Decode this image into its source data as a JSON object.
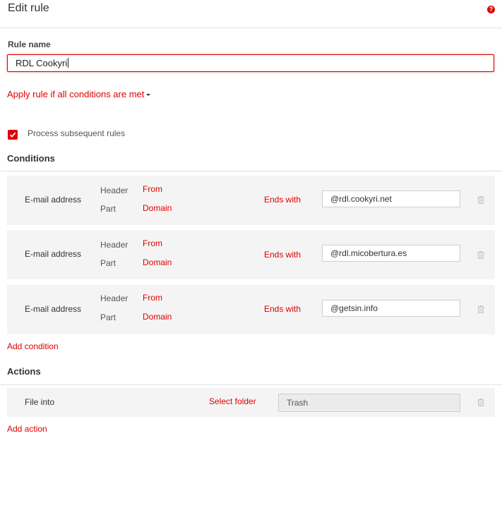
{
  "header": {
    "title": "Edit rule",
    "help_icon": "help-icon",
    "help_glyph": "?"
  },
  "rule_name": {
    "label": "Rule name",
    "value": "RDL Cookyri"
  },
  "apply_mode": {
    "label": "Apply rule if all conditions are met"
  },
  "process_subsequent": {
    "label": "Process subsequent rules",
    "checked": true
  },
  "conditions": {
    "title": "Conditions",
    "rows": [
      {
        "field": "E-mail address",
        "header_label": "Header",
        "header_value": "From",
        "part_label": "Part",
        "part_value": "Domain",
        "operator": "Ends with",
        "value": "@rdl.cookyri.net"
      },
      {
        "field": "E-mail address",
        "header_label": "Header",
        "header_value": "From",
        "part_label": "Part",
        "part_value": "Domain",
        "operator": "Ends with",
        "value": "@rdl.micobertura.es"
      },
      {
        "field": "E-mail address",
        "header_label": "Header",
        "header_value": "From",
        "part_label": "Part",
        "part_value": "Domain",
        "operator": "Ends with",
        "value": "@getsin.info"
      }
    ],
    "add_label": "Add condition"
  },
  "actions": {
    "title": "Actions",
    "rows": [
      {
        "action": "File into",
        "select_label": "Select folder",
        "folder": "Trash"
      }
    ],
    "add_label": "Add action"
  },
  "colors": {
    "accent": "#e00000",
    "row_bg": "#f4f4f4",
    "divider": "#e3e3e3"
  }
}
